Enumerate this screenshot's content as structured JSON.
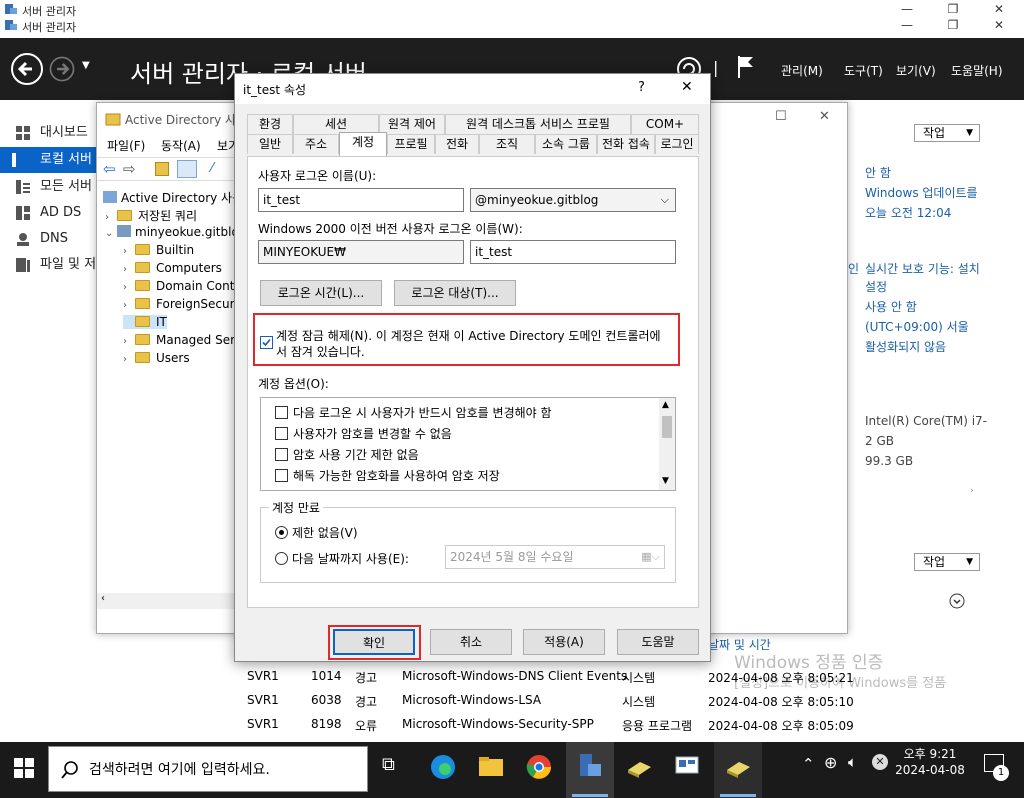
{
  "window": {
    "title_line1": "서버 관리자",
    "title_line2": "서버 관리자"
  },
  "header": {
    "title": "서버 관리자 · 로컬 서버",
    "menu": [
      "관리(M)",
      "도구(T)",
      "보기(V)",
      "도움말(H)"
    ]
  },
  "sidebar": {
    "items": [
      {
        "label": "대시보드",
        "icon": "dashboard-icon"
      },
      {
        "label": "로컬 서버",
        "icon": "local-server-icon"
      },
      {
        "label": "모든 서버",
        "icon": "all-servers-icon"
      },
      {
        "label": "AD DS",
        "icon": "ad-ds-icon"
      },
      {
        "label": "DNS",
        "icon": "dns-icon"
      },
      {
        "label": "파일 및 저장소",
        "icon": "file-storage-icon"
      }
    ]
  },
  "properties": {
    "tasks_label": "작업",
    "right_values": [
      "안 함",
      "Windows 업데이트를",
      "오늘 오전 12:04"
    ],
    "right_values2": [
      "실시간 보호 기능: 설치",
      "설정",
      "사용 안 함",
      "(UTC+09:00) 서울",
      "활성화되지 않음"
    ],
    "right_values3": [
      "Intel(R) Core(TM) i7-",
      "2 GB",
      "99.3 GB"
    ],
    "mid_fragment": "인"
  },
  "events": {
    "tasks_label": "작업",
    "date_col_header": "날짜 및 시간",
    "rows": [
      {
        "server": "SVR1",
        "id": "1014",
        "level": "경고",
        "source": "Microsoft-Windows-DNS Client Events",
        "log": "시스템",
        "time": "2024-04-08 오후 8:05:21"
      },
      {
        "server": "SVR1",
        "id": "6038",
        "level": "경고",
        "source": "Microsoft-Windows-LSA",
        "log": "시스템",
        "time": "2024-04-08 오후 8:05:10"
      },
      {
        "server": "SVR1",
        "id": "8198",
        "level": "오류",
        "source": "Microsoft-Windows-Security-SPP",
        "log": "응용 프로그램",
        "time": "2024-04-08 오후 8:05:09"
      }
    ]
  },
  "watermark": {
    "line1": "Windows 정품 인증",
    "line2": "[설정]으로 이동하여 Windows를 정품"
  },
  "ad_window": {
    "title": "Active Directory 사용",
    "menu": [
      "파일(F)",
      "동작(A)",
      "보기"
    ],
    "tree": [
      {
        "label": "Active Directory 사용",
        "level": 0,
        "caret": ""
      },
      {
        "label": "저장된 쿼리",
        "level": 1,
        "caret": "›"
      },
      {
        "label": "minyeokue.gitblog",
        "level": 1,
        "caret": "⌄"
      },
      {
        "label": "Builtin",
        "level": 2,
        "caret": "›"
      },
      {
        "label": "Computers",
        "level": 2,
        "caret": "›"
      },
      {
        "label": "Domain Cont",
        "level": 2,
        "caret": "›"
      },
      {
        "label": "ForeignSecuri",
        "level": 2,
        "caret": "›"
      },
      {
        "label": "IT",
        "level": 2,
        "caret": ""
      },
      {
        "label": "Managed Serv",
        "level": 2,
        "caret": "›"
      },
      {
        "label": "Users",
        "level": 2,
        "caret": "›"
      }
    ]
  },
  "dialog": {
    "title": "it_test 속성",
    "help_label": "?",
    "tabs_row1": [
      "환경",
      "세션",
      "원격 제어",
      "원격 데스크톱 서비스 프로필",
      "COM+"
    ],
    "tabs_row2": [
      "일반",
      "주소",
      "계정",
      "프로필",
      "전화",
      "조직",
      "소속 그룹",
      "전화 접속",
      "로그인"
    ],
    "logon_name_label": "사용자 로그온 이름(U):",
    "logon_name_value": "it_test",
    "upn_suffix": "@minyeokue.gitblog",
    "pre2000_label": "Windows 2000 이전 버전 사용자 로그온 이름(W):",
    "pre2000_domain": "MINYEOKUE₩",
    "pre2000_name": "it_test",
    "logon_hours_btn": "로그온 시간(L)...",
    "logon_to_btn": "로그온 대상(T)...",
    "unlock_text_line1": "계정 잠금 해제(N). 이 계정은 현재 이 Active Directory 도메인 컨트롤러에",
    "unlock_text_line2": "서 잠겨 있습니다.",
    "account_options_label": "계정 옵션(O):",
    "account_options": [
      "다음 로그온 시 사용자가 반드시 암호를 변경해야 함",
      "사용자가 암호를 변경할 수 없음",
      "암호 사용 기간 제한 없음",
      "해독 가능한 암호화를 사용하여 암호 저장"
    ],
    "expires_label": "계정 만료",
    "never_label": "제한 없음(V)",
    "end_of_label": "다음 날짜까지 사용(E):",
    "date_value": "2024년   5월   8일 수요일",
    "ok": "확인",
    "cancel": "취소",
    "apply": "적용(A)",
    "help": "도움말"
  },
  "taskbar": {
    "search_placeholder": "검색하려면 여기에 입력하세요.",
    "time": "오후 9:21",
    "date": "2024-04-08",
    "notification_count": "1"
  }
}
